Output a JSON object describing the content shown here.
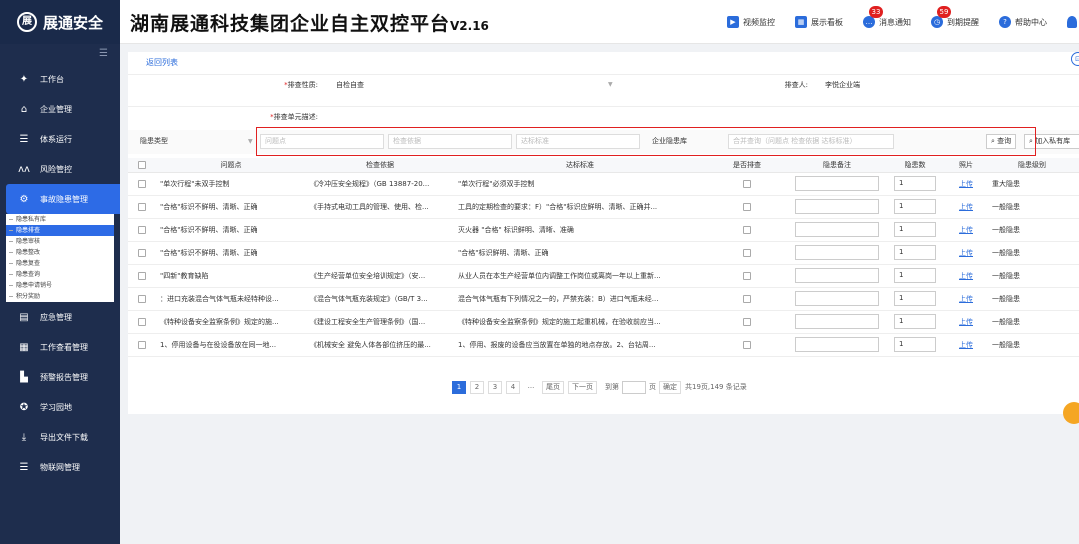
{
  "header": {
    "logo_text": "展通安全",
    "logo_mark": "展",
    "title": "湖南展通科技集团企业自主双控平台",
    "version": "V2.16",
    "actions": [
      {
        "name": "video-monitor",
        "label": "视频监控",
        "badge": ""
      },
      {
        "name": "dashboard",
        "label": "展示看板",
        "badge": ""
      },
      {
        "name": "messages",
        "label": "消息通知",
        "badge": "33"
      },
      {
        "name": "expiry",
        "label": "到期提醒",
        "badge": "59"
      },
      {
        "name": "help",
        "label": "帮助中心",
        "badge": ""
      }
    ]
  },
  "sidebar": {
    "items": [
      {
        "label": "工作台",
        "icon": "✦"
      },
      {
        "label": "企业管理",
        "icon": "⌂"
      },
      {
        "label": "体系运行",
        "icon": "☰"
      },
      {
        "label": "风险管控",
        "icon": "ʌʌ"
      },
      {
        "label": "事故隐患管理",
        "icon": "⚙"
      },
      {
        "label": "应急管理",
        "icon": "▤"
      },
      {
        "label": "工作查看管理",
        "icon": "▦"
      },
      {
        "label": "预警报告管理",
        "icon": "▙"
      },
      {
        "label": "学习园地",
        "icon": "✪"
      },
      {
        "label": "导出文件下载",
        "icon": "⤓"
      },
      {
        "label": "物联网管理",
        "icon": "☰"
      }
    ],
    "sub_items": [
      "隐患私有库",
      "隐患排查",
      "隐患审核",
      "隐患整改",
      "隐患复查",
      "隐患查询",
      "隐患申请销号",
      "积分奖励"
    ]
  },
  "main": {
    "back_label": "返回列表",
    "form": {
      "nature_label": "排查性质:",
      "nature_value": "自检自查",
      "inspector_label": "排查人:",
      "inspector_value": "李悦企业端",
      "unit_label": "排查单元描述:"
    },
    "filters": {
      "hazard_type": "隐患类型",
      "problem_placeholder": "问题点",
      "basis_placeholder": "检查依据",
      "standard_placeholder": "达标标准",
      "library": "企业隐患库",
      "combined_placeholder": "合并查询（问题点 检查依据 达标标准）",
      "search_label": "查询",
      "add_private_label": "加入私有库"
    },
    "columns": [
      "问题点",
      "检查依据",
      "达标标准",
      "是否排查",
      "隐患备注",
      "隐患数",
      "照片",
      "隐患级别"
    ],
    "rows": [
      {
        "problem": "\"单次行程\"未双手控制",
        "basis": "《冷冲压安全规程》（GB 13887-20...",
        "standard": "\"单次行程\"必须双手控制",
        "count": "1",
        "photo": "上传",
        "level": "重大隐患"
      },
      {
        "problem": "\"合格\"标识不鲜明、清晰、正确",
        "basis": "《手持式电动工具的管理、使用、检...",
        "standard": "工具的定期检查的要求：F）\"合格\"标识应鲜明、清晰、正确并...",
        "count": "1",
        "photo": "上传",
        "level": "一般隐患"
      },
      {
        "problem": "\"合格\"标识不鲜明、清晰、正确",
        "basis": "",
        "standard": "灭火器 \"合格\" 标识鲜明、清晰、准确",
        "count": "1",
        "photo": "上传",
        "level": "一般隐患"
      },
      {
        "problem": "\"合格\"标识不鲜明、清晰、正确",
        "basis": "",
        "standard": "\"合格\"标识鲜明、清晰、正确",
        "count": "1",
        "photo": "上传",
        "level": "一般隐患"
      },
      {
        "problem": "\"四新\"教育缺陷",
        "basis": "《生产经营单位安全培训规定》（安...",
        "standard": "从业人员在本生产经营单位内调整工作岗位或离岗一年以上重新...",
        "count": "1",
        "photo": "上传",
        "level": "一般隐患"
      },
      {
        "problem": "：进口充装混合气体气瓶未经特种设...",
        "basis": "《混合气体气瓶充装规定》（GB/T 3...",
        "standard": "混合气体气瓶有下列情况之一的，严禁充装：B）进口气瓶未经...",
        "count": "1",
        "photo": "上传",
        "level": "一般隐患"
      },
      {
        "problem": "《特种设备安全监察条例》规定的施...",
        "basis": "《建设工程安全生产管理条例》（国...",
        "standard": "《特种设备安全监察条例》规定的施工起重机械，在验收前应当...",
        "count": "1",
        "photo": "上传",
        "level": "一般隐患"
      },
      {
        "problem": "1、停用设备与在役设备放在同一地...",
        "basis": "《机械安全 避免人体各部位挤压的最...",
        "standard": "1、停用、报废的设备应当放置在单独的地点存放。2、台钻周...",
        "count": "1",
        "photo": "上传",
        "level": "一般隐患"
      }
    ],
    "pager": {
      "pages": [
        "1",
        "2",
        "3",
        "4",
        "..."
      ],
      "first": "尾页",
      "next": "下一页",
      "goto": "到第",
      "page_unit": "页",
      "confirm": "确定",
      "summary": "共19页,149 条记录"
    }
  }
}
